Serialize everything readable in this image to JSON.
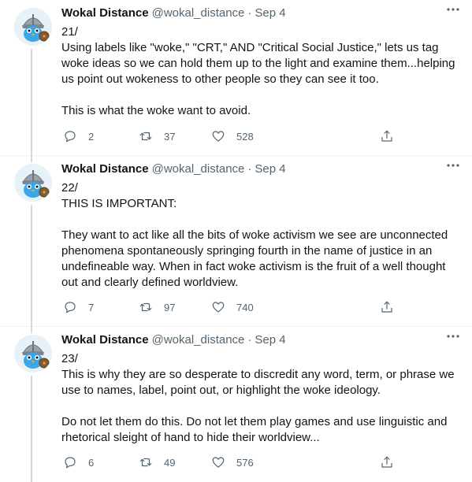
{
  "tweets": [
    {
      "author_name": "Wokal Distance",
      "handle": "@wokal_distance",
      "separator": "·",
      "date": "Sep 4",
      "body": "21/\nUsing labels like \"woke,\" \"CRT,\" AND \"Critical Social Justice,\" lets us tag\nwoke ideas so we can hold them up to the light and examine them...helping\nus point out wokeness to other people so they can see it too.\n\nThis is what the woke want to avoid.",
      "replies": "2",
      "retweets": "37",
      "likes": "528"
    },
    {
      "author_name": "Wokal Distance",
      "handle": "@wokal_distance",
      "separator": "·",
      "date": "Sep 4",
      "body": "22/\nTHIS IS IMPORTANT:\n\nThey want to act like all the bits of woke activism we see are unconnected\nphenomena spontaneously springing fourth in the name of justice in an\nundefineable way. When in fact woke activism is the fruit of a well thought\nout and clearly defined worldview.",
      "replies": "7",
      "retweets": "97",
      "likes": "740"
    },
    {
      "author_name": "Wokal Distance",
      "handle": "@wokal_distance",
      "separator": "·",
      "date": "Sep 4",
      "body": "23/\nThis is why they are so desperate to discredit any word, term, or phrase we\nuse to names, label, point out, or highlight the woke ideology.\n\nDo not let them do this. Do not let them play games and use linguistic and\nrhetorical sleight of hand to hide their worldview...",
      "replies": "6",
      "retweets": "49",
      "likes": "576"
    }
  ],
  "icons": {
    "avatar": "viking-bird-avatar",
    "more": "more-horizontal-icon",
    "reply": "reply-icon",
    "retweet": "retweet-icon",
    "like": "heart-icon",
    "share": "share-icon"
  },
  "colors": {
    "text_primary": "#0f1419",
    "text_secondary": "#536471",
    "thread_line": "#cfd9de",
    "avatar_bird": "#3aa7e6"
  }
}
